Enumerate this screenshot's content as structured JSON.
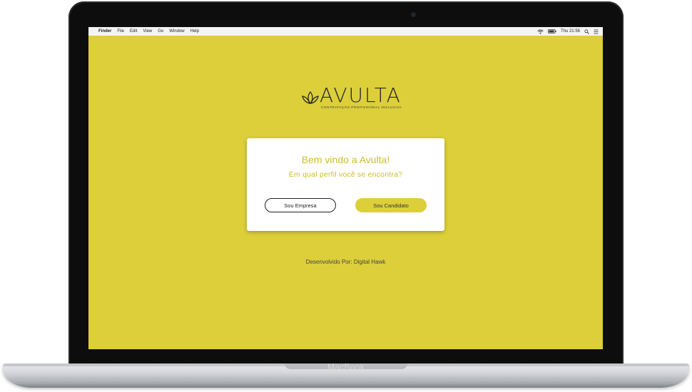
{
  "device": {
    "brand_label": "MacBook"
  },
  "menubar": {
    "apple_glyph": "",
    "items": [
      "Finder",
      "File",
      "Edit",
      "View",
      "Go",
      "Window",
      "Help"
    ],
    "status": {
      "time": "Thu 21:56"
    }
  },
  "logo": {
    "name": "AVULTA",
    "tagline": "CONTRATAÇÃO PROFISSIONAL INCLUSIVA"
  },
  "card": {
    "title": "Bem vindo a Avulta!",
    "subtitle": "Em qual perfil você se encontra?",
    "buttons": {
      "empresa": "Sou Empresa",
      "candidato": "Sou Candidato"
    }
  },
  "footer": {
    "text": "Desenvolvido Por: Digital Hawk"
  },
  "colors": {
    "background": "#dccf3a",
    "accent_text": "#cbbe2a",
    "card": "#ffffff"
  },
  "icons": [
    "apple-icon",
    "wifi-icon",
    "battery-icon",
    "search-icon",
    "list-icon",
    "lotus-logo-icon"
  ]
}
